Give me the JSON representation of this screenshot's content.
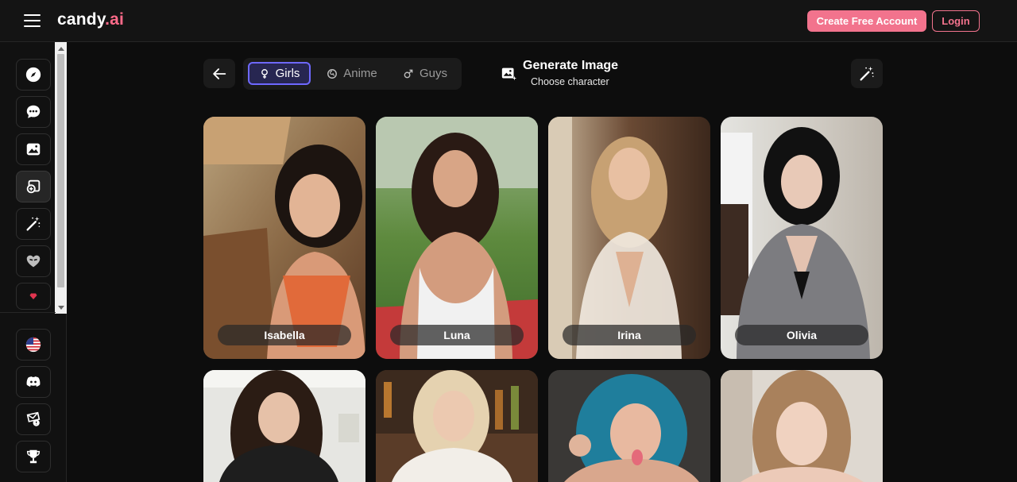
{
  "header": {
    "logo_main": "candy",
    "logo_accent": ".ai",
    "create_account_label": "Create Free Account",
    "login_label": "Login"
  },
  "sidebar": {
    "items": [
      {
        "icon": "compass-icon"
      },
      {
        "icon": "chat-icon"
      },
      {
        "icon": "image-gallery-icon"
      },
      {
        "icon": "create-character-icon",
        "active": true
      },
      {
        "icon": "magic-wand-icon"
      },
      {
        "icon": "heart-mask-icon"
      },
      {
        "icon": "gem-icon"
      }
    ],
    "footer_items": [
      {
        "icon": "us-flag-icon"
      },
      {
        "icon": "discord-icon"
      },
      {
        "icon": "support-icon"
      },
      {
        "icon": "trophy-icon"
      }
    ]
  },
  "filters": {
    "tabs": [
      {
        "label": "Girls",
        "icon": "female-icon",
        "active": true
      },
      {
        "label": "Anime",
        "icon": "anime-icon",
        "active": false
      },
      {
        "label": "Guys",
        "icon": "male-icon",
        "active": false
      }
    ]
  },
  "generate": {
    "title": "Generate Image",
    "subtitle": "Choose character"
  },
  "characters": [
    {
      "name": "Isabella"
    },
    {
      "name": "Luna"
    },
    {
      "name": "Irina"
    },
    {
      "name": "Olivia"
    },
    {
      "name": ""
    },
    {
      "name": ""
    },
    {
      "name": ""
    },
    {
      "name": ""
    }
  ],
  "colors": {
    "accent_pink": "#f2738d",
    "tab_active_border": "#6e68ff",
    "background": "#0d0d0d"
  }
}
